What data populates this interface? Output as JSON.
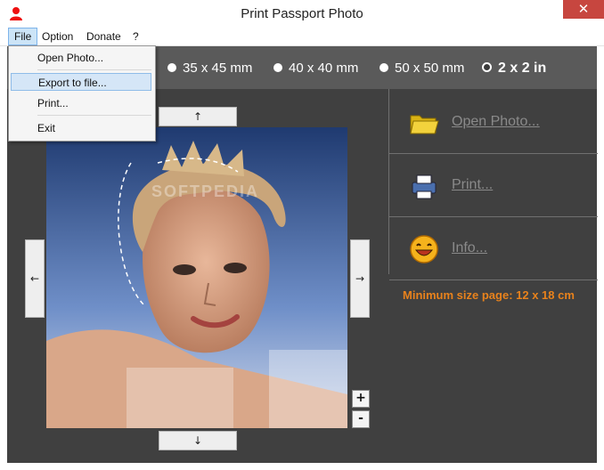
{
  "window": {
    "title": "Print Passport Photo",
    "close_glyph": "✕"
  },
  "menubar": {
    "items": [
      "File",
      "Option",
      "Donate",
      "?"
    ]
  },
  "file_menu": {
    "items": [
      "Open Photo...",
      "Export to file...",
      "Print...",
      "Exit"
    ],
    "highlighted": "Export to file..."
  },
  "sizes": {
    "options": [
      "35 x 45 mm",
      "40 x 40 mm",
      "50 x 50 mm",
      "2 x 2 in"
    ],
    "selected": "2 x 2 in"
  },
  "actions": {
    "open": "Open Photo...",
    "print": "Print...",
    "info": "Info..."
  },
  "min_size": "Minimum size page: 12 x 18 cm",
  "nav": {
    "up": "↑",
    "down": "↓",
    "left": "←",
    "right": "→",
    "zoom_in": "+",
    "zoom_out": "-"
  },
  "watermark": "SOFTPEDIA",
  "colors": {
    "background": "#404040",
    "size_bar": "#5a5a5a",
    "accent_orange": "#e8821c",
    "close_red": "#c7463f"
  }
}
